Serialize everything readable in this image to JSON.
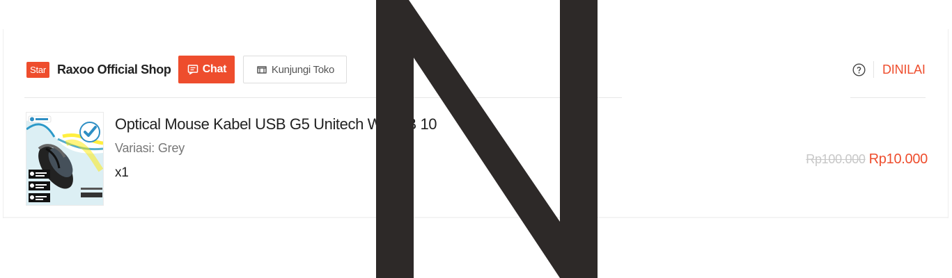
{
  "shop": {
    "badge": "Star",
    "name": "Raxoo Official Shop",
    "chat_label": "Chat",
    "visit_label": "Kunjungi Toko",
    "status": "DINILAI"
  },
  "product": {
    "title": "Optical Mouse Kabel USB G5 Unitech W     USB 10",
    "variant": "Variasi: Grey",
    "quantity": "x1",
    "original_price": "Rp100.000",
    "price": "Rp10.000"
  },
  "overlay": {
    "letter": "N"
  },
  "icons": {
    "chat": "chat-icon",
    "visit_shop": "shop-icon",
    "help": "help-icon",
    "product": "product-image"
  },
  "colors": {
    "accent": "#ee4d2d",
    "overlay": "#2d2928",
    "muted": "#777777"
  }
}
